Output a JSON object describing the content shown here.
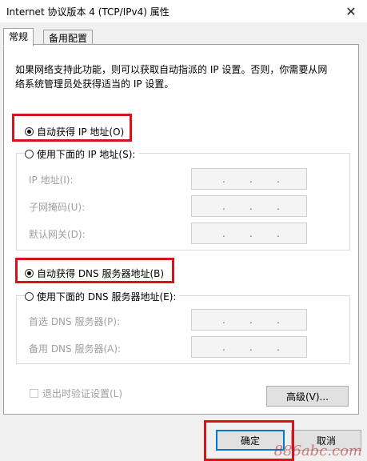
{
  "window": {
    "title": "Internet 协议版本 4 (TCP/IPv4) 属性",
    "close_icon": "✕"
  },
  "tabs": [
    {
      "label": "常规",
      "active": true
    },
    {
      "label": "备用配置",
      "active": false
    }
  ],
  "intro_text": "如果网络支持此功能，则可以获取自动指派的 IP 设置。否则，你需要从网络系统管理员处获得适当的 IP 设置。",
  "ip_section": {
    "auto_label": "自动获得 IP 地址(O)",
    "auto_selected": true,
    "manual_label": "使用下面的 IP 地址(S):",
    "fields": [
      {
        "label": "IP 地址(I):",
        "value": ".   .   ."
      },
      {
        "label": "子网掩码(U):",
        "value": ".   .   ."
      },
      {
        "label": "默认网关(D):",
        "value": ".   .   ."
      }
    ]
  },
  "dns_section": {
    "auto_label": "自动获得 DNS 服务器地址(B)",
    "auto_selected": true,
    "manual_label": "使用下面的 DNS 服务器地址(E):",
    "fields": [
      {
        "label": "首选 DNS 服务器(P):",
        "value": ".   .   ."
      },
      {
        "label": "备用 DNS 服务器(A):",
        "value": ".   .   ."
      }
    ]
  },
  "validate_label": "退出时验证设置(L)",
  "advanced_label": "高级(V)...",
  "ok_label": "确定",
  "cancel_label": "取消",
  "watermark": "886abc.com",
  "colors": {
    "highlight": "#d8111b",
    "accent": "#0078d7"
  }
}
